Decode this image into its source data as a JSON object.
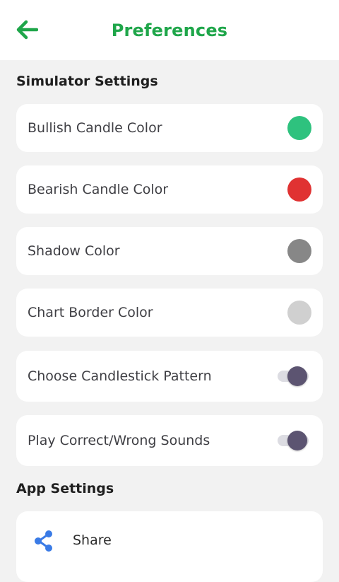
{
  "header": {
    "title": "Preferences",
    "back_icon": "arrow-left-icon"
  },
  "simulator_settings": {
    "heading": "Simulator Settings",
    "bullish": {
      "label": "Bullish Candle Color",
      "color": "#2ec27e"
    },
    "bearish": {
      "label": "Bearish Candle Color",
      "color": "#e03232"
    },
    "shadow": {
      "label": "Shadow Color",
      "color": "#878787"
    },
    "border": {
      "label": "Chart Border Color",
      "color": "#d0d0d0"
    },
    "pattern": {
      "label": "Choose Candlestick Pattern",
      "enabled": true
    },
    "sounds": {
      "label": "Play Correct/Wrong Sounds",
      "enabled": true
    }
  },
  "app_settings": {
    "heading": "App Settings",
    "share": {
      "label": "Share",
      "icon": "share-icon"
    }
  },
  "colors": {
    "accent": "#1fa64a",
    "share_icon": "#3a7be6",
    "toggle_knob": "#5c5471",
    "toggle_track": "#dcdce2"
  }
}
